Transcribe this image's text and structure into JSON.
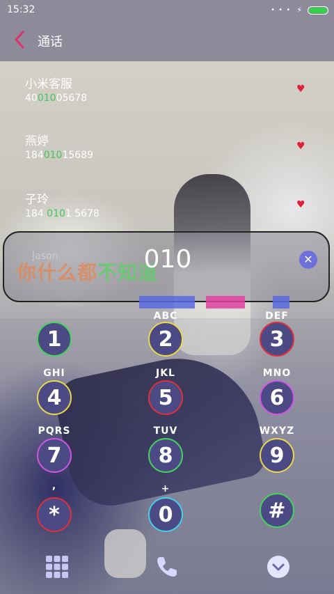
{
  "status": {
    "time": "15:32",
    "dots": "• • •",
    "charging": "⚡"
  },
  "header": {
    "title": "通话"
  },
  "contacts": [
    {
      "name": "小米客服",
      "num_pre": "40",
      "num_hl": "010",
      "num_post": "05678"
    },
    {
      "name": "燕婷",
      "num_pre": "184",
      "num_hl": "010",
      "num_post": "15689"
    },
    {
      "name": "子玲",
      "num_pre": "184 ",
      "num_hl": "010",
      "num_post": "1 5678"
    }
  ],
  "dial": {
    "number": "010",
    "hint": "Jason",
    "slogan_a": "你什么都",
    "slogan_b": "不知道",
    "clear_symbol": "✕"
  },
  "keys": [
    {
      "digit": "1",
      "letters": "",
      "color": "#45d35c"
    },
    {
      "digit": "2",
      "letters": "ABC",
      "color": "#e8d94a"
    },
    {
      "digit": "3",
      "letters": "DEF",
      "color": "#e0303a"
    },
    {
      "digit": "4",
      "letters": "GHI",
      "color": "#e8d94a"
    },
    {
      "digit": "5",
      "letters": "JKL",
      "color": "#e0303a"
    },
    {
      "digit": "6",
      "letters": "MNO",
      "color": "#d055e0"
    },
    {
      "digit": "7",
      "letters": "PQRS",
      "color": "#d055e0"
    },
    {
      "digit": "8",
      "letters": "TUV",
      "color": "#45d35c"
    },
    {
      "digit": "9",
      "letters": "WXYZ",
      "color": "#e8d94a"
    },
    {
      "digit": "*",
      "letters": ",",
      "color": "#e0303a"
    },
    {
      "digit": "0",
      "letters": "+",
      "color": "#45d0e8"
    },
    {
      "digit": "#",
      "letters": "",
      "color": "#45d35c"
    }
  ]
}
